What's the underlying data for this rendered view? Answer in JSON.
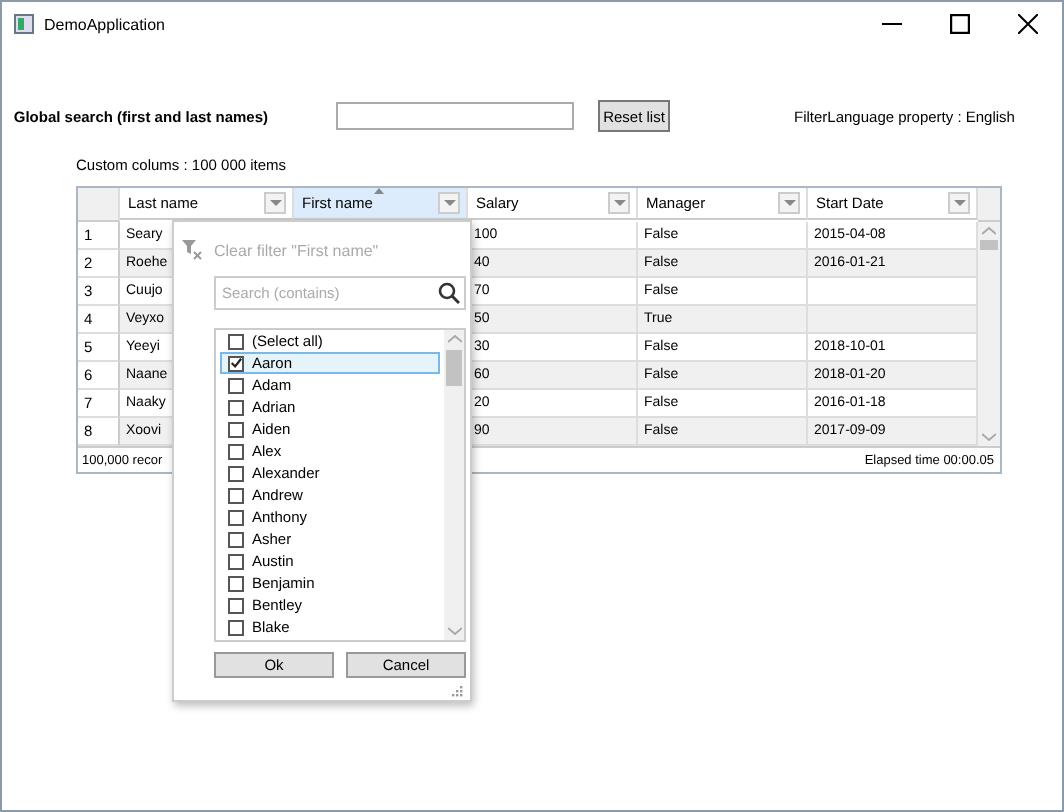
{
  "window": {
    "title": "DemoApplication"
  },
  "search": {
    "label": "Global search (first and last names)",
    "button": "Reset list"
  },
  "filter_language": "FilterLanguage property : English",
  "items_label": "Custom colums :  100 000 items",
  "grid": {
    "columns": [
      {
        "label": "Last name",
        "selected": false,
        "sorted": false
      },
      {
        "label": "First name",
        "selected": true,
        "sorted": true
      },
      {
        "label": "Salary",
        "selected": false,
        "sorted": false
      },
      {
        "label": "Manager",
        "selected": false,
        "sorted": false
      },
      {
        "label": "Start Date",
        "selected": false,
        "sorted": false
      }
    ],
    "rows": [
      {
        "number": "1",
        "last_name": "Seary",
        "salary": "100",
        "manager": "False",
        "start_date": "2015-04-08"
      },
      {
        "number": "2",
        "last_name": "Roehe",
        "salary": "40",
        "manager": "False",
        "start_date": "2016-01-21"
      },
      {
        "number": "3",
        "last_name": "Cuujo",
        "salary": "70",
        "manager": "False"
      },
      {
        "number": "4",
        "last_name": "Veyxo",
        "salary": "50",
        "manager": "True"
      },
      {
        "number": "5",
        "last_name": "Yeeyi",
        "salary": "30",
        "manager": "False",
        "start_date": "2018-10-01"
      },
      {
        "number": "6",
        "last_name": "Naane",
        "salary": "60",
        "manager": "False",
        "start_date": "2018-01-20"
      },
      {
        "number": "7",
        "last_name": "Naaky",
        "salary": "20",
        "manager": "False",
        "start_date": "2016-01-18"
      },
      {
        "number": "8",
        "last_name": "Xoovi",
        "salary": "90",
        "manager": "False",
        "start_date": "2017-09-09"
      }
    ],
    "footer": {
      "count": "100,000 recor",
      "elapsed": "Elapsed time 00:00.05"
    }
  },
  "filter_popup": {
    "clear": "Clear filter \"First name\"",
    "clear_disabled": true,
    "search_placeholder": "Search (contains)",
    "items": [
      {
        "label": "(Select all)",
        "checked": false,
        "selected": false
      },
      {
        "label": "Aaron",
        "checked": true,
        "selected": true
      },
      {
        "label": "Adam",
        "checked": false,
        "selected": false
      },
      {
        "label": "Adrian",
        "checked": false,
        "selected": false
      },
      {
        "label": "Aiden",
        "checked": false,
        "selected": false
      },
      {
        "label": "Alex",
        "checked": false,
        "selected": false
      },
      {
        "label": "Alexander",
        "checked": false,
        "selected": false
      },
      {
        "label": "Andrew",
        "checked": false,
        "selected": false
      },
      {
        "label": "Anthony",
        "checked": false,
        "selected": false
      },
      {
        "label": "Asher",
        "checked": false,
        "selected": false
      },
      {
        "label": "Austin",
        "checked": false,
        "selected": false
      },
      {
        "label": "Benjamin",
        "checked": false,
        "selected": false
      },
      {
        "label": "Bentley",
        "checked": false,
        "selected": false
      },
      {
        "label": "Blake",
        "checked": false,
        "selected": false
      }
    ],
    "buttons": [
      "Ok",
      "Cancel"
    ]
  }
}
